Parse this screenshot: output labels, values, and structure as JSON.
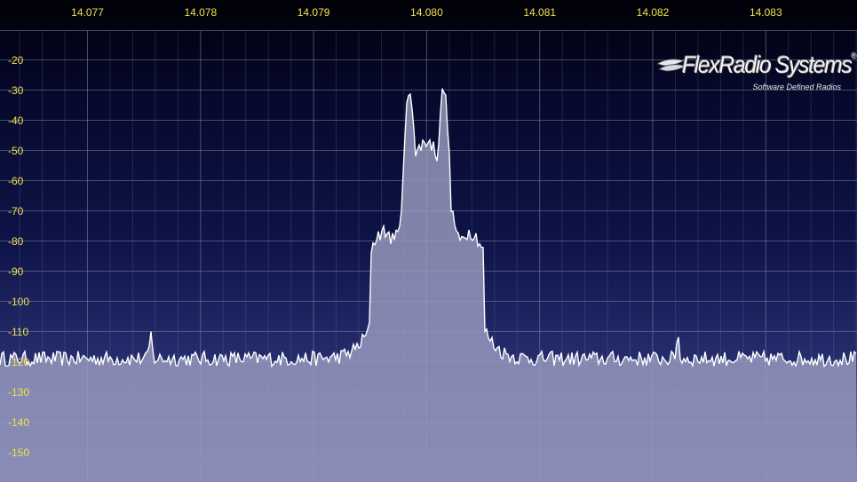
{
  "frequency_axis": {
    "labels": [
      "14.077",
      "14.078",
      "14.079",
      "14.080",
      "14.081",
      "14.082",
      "14.083"
    ]
  },
  "db_axis": {
    "labels": [
      "-20",
      "-30",
      "-40",
      "-50",
      "-60",
      "-70",
      "-80",
      "-90",
      "-100",
      "-110",
      "-120",
      "-130",
      "-140",
      "-150"
    ]
  },
  "logo": {
    "name": "FlexRadio Systems",
    "mark": "®",
    "tagline": "Software Defined Radios"
  },
  "colors": {
    "axis_label": "#f0e24a",
    "spectrum_fill": "#9a9cc0",
    "spectrum_line": "#ffffff",
    "grid": "#8088aa"
  },
  "spectrum_data": {
    "x_unit": "MHz",
    "y_unit": "dB",
    "noise_floor_db": -119,
    "peaks": [
      {
        "freq_mhz": 14.07985,
        "level_db": -30
      },
      {
        "freq_mhz": 14.08015,
        "level_db": -30
      },
      {
        "freq_mhz": 14.07756,
        "level_db": -111
      },
      {
        "freq_mhz": 14.08222,
        "level_db": -111
      }
    ]
  }
}
